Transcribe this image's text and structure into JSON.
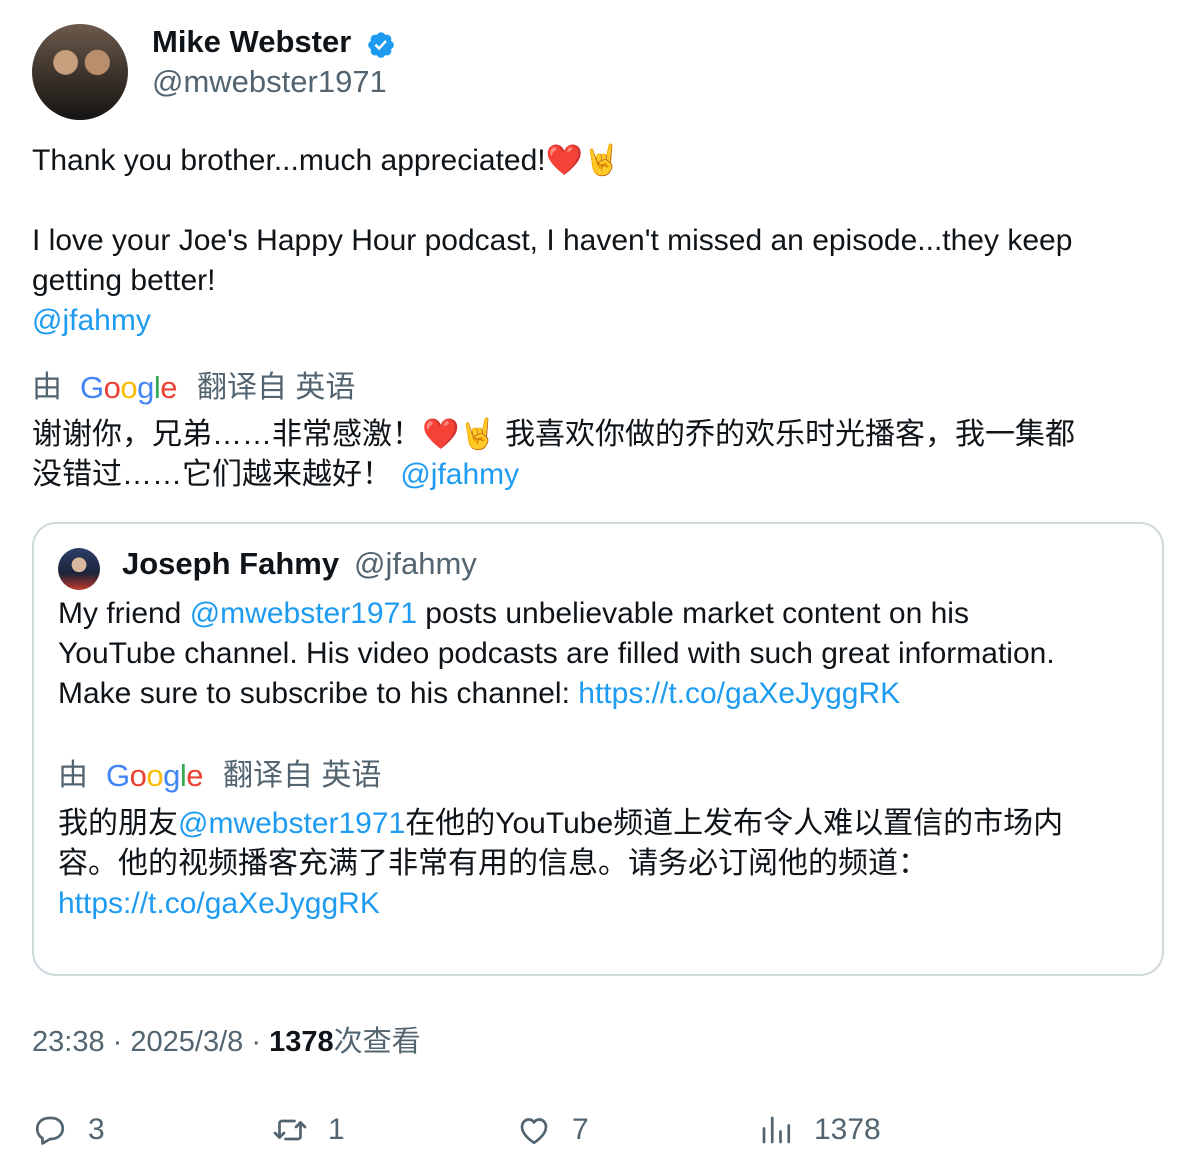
{
  "author": {
    "name": "Mike Webster",
    "handle": "@mwebster1971"
  },
  "tweet": {
    "line1": "Thank you brother...much appreciated!",
    "line1_emoji": "❤️🤘",
    "line2": "I love your Joe's Happy Hour podcast, I haven't missed an episode...they keep",
    "line3": "getting better!",
    "mention": "@jfahmy",
    "translation_label_prefix": "由",
    "translation_label_suffix": "翻译自 英语",
    "translation_line1_a": "谢谢你，兄弟……非常感激！",
    "translation_line1_emoji": "❤️🤘",
    "translation_line1_b": " 我喜欢你做的乔的欢乐时光播客，我一集都",
    "translation_line2": "没错过……它们越来越好！",
    "translation_mention": "@jfahmy"
  },
  "quote": {
    "name": "Joseph Fahmy",
    "handle": "@jfahmy",
    "line1_a": "My friend ",
    "line1_mention": "@mwebster1971",
    "line1_b": " posts unbelievable market content on his",
    "line2": "YouTube channel. His video podcasts are filled with such great information.",
    "line3_a": "Make sure to subscribe to his channel: ",
    "link": "https://t.co/gaXeJyggRK",
    "translation_label_prefix": "由",
    "translation_label_suffix": "翻译自 英语",
    "t_line1_a": "我的朋友",
    "t_line1_mention": "@mwebster1971",
    "t_line1_b": "在他的YouTube频道上发布令人难以置信的市场内",
    "t_line2": "容。他的视频播客充满了非常有用的信息。请务必订阅他的频道：",
    "t_link": "https://t.co/gaXeJyggRK"
  },
  "meta": {
    "time": "23:38",
    "date": "2025/3/8",
    "views_count": "1378",
    "views_label": "次查看",
    "separator": "·"
  },
  "actions": {
    "replies": "3",
    "reposts": "1",
    "likes": "7",
    "views": "1378"
  },
  "colors": {
    "accent": "#1d9bf0",
    "secondary_text": "#536471",
    "border": "#cfd9de"
  }
}
